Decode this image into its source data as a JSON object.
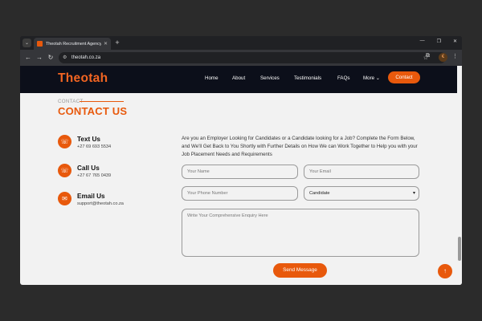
{
  "browser": {
    "tab_title": "Theotah Recruitment Agency |",
    "url": "theotah.co.za",
    "profile_initial": "€",
    "icons": {
      "tab_menu": "chevron-down-icon",
      "close": "close-icon",
      "new_tab": "plus-icon",
      "back": "arrow-left-icon",
      "forward": "arrow-right-icon",
      "reload": "reload-icon",
      "site_info": "tune-icon",
      "bookmark": "star-icon",
      "extensions": "puzzle-icon",
      "menu": "kebab-icon"
    }
  },
  "site": {
    "logo": "Theotah",
    "nav": [
      "Home",
      "About",
      "Services",
      "Testimonials",
      "FAQs",
      "More"
    ],
    "nav_more_caret": "⌄",
    "contact_button": "Contact",
    "brand_color": "#e8590c"
  },
  "contact": {
    "kicker": "CONTACT",
    "heading": "CONTACT US",
    "items": [
      {
        "title": "Text Us",
        "value": "+27 69 693 5534",
        "icon": "phone-icon"
      },
      {
        "title": "Call Us",
        "value": "+27 67 765 0439",
        "icon": "phone-icon"
      },
      {
        "title": "Email Us",
        "value": "support@theotah.co.za",
        "icon": "mail-icon"
      }
    ],
    "intro": "Are you an Employer Looking for Candidates or a Candidate looking for a Job? Complete the Form Below, and We'll Get Back to You Shortly with Further Details on How We can Work Together to Help you with your Job Placement Needs and Requirements",
    "form": {
      "name_placeholder": "Your Name",
      "email_placeholder": "Your Email",
      "phone_placeholder": "Your Phone Number",
      "role_selected": "Candidate",
      "enquiry_placeholder": "Write Your Comprehensive Enquiry Here",
      "submit_label": "Send Message"
    }
  }
}
